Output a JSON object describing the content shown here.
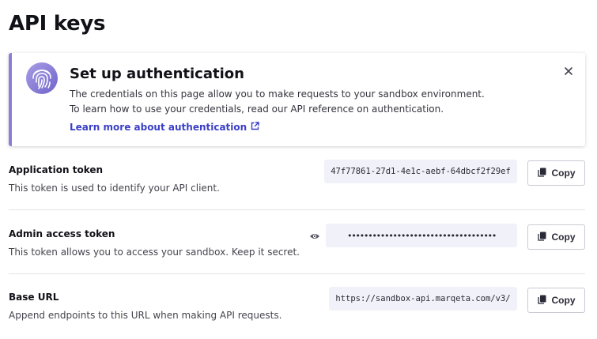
{
  "page": {
    "title": "API keys"
  },
  "banner": {
    "title": "Set up authentication",
    "body": "The credentials on this page allow you to make requests to your sandbox environment. To learn how to use your credentials, read our API reference on authentication.",
    "link_label": "Learn more about authentication",
    "icon": "fingerprint-icon",
    "accent_color": "#8a7fd6",
    "link_color": "#3a3fc6"
  },
  "credentials": [
    {
      "label": "Application token",
      "description": "This token is used to identify your API client.",
      "value": "47f77861-27d1-4e1c-aebf-64dbcf2f29ef",
      "copy_label": "Copy",
      "masked": false
    },
    {
      "label": "Admin access token",
      "description": "This token allows you to access your sandbox. Keep it secret.",
      "value": "••••••••••••••••••••••••••••••••••••",
      "copy_label": "Copy",
      "masked": true
    },
    {
      "label": "Base URL",
      "description": "Append endpoints to this URL when making API requests.",
      "value": "https://sandbox-api.marqeta.com/v3/",
      "copy_label": "Copy",
      "masked": false
    }
  ]
}
